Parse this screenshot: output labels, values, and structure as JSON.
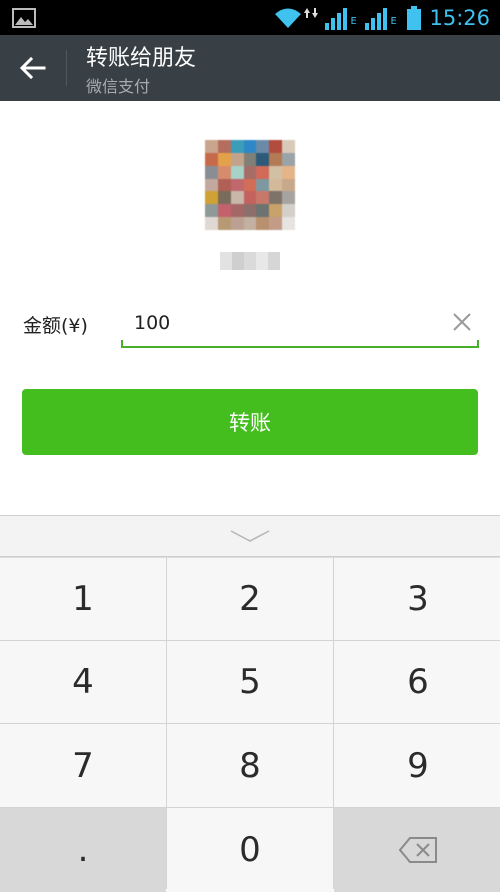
{
  "status_bar": {
    "time": "15:26",
    "network_badge_1": "E",
    "network_badge_2": "E",
    "icons": [
      "gallery-icon",
      "wifi-icon",
      "data-transfer-icon",
      "signal-icon",
      "signal-icon",
      "battery-icon"
    ],
    "time_color": "#3fc2ef"
  },
  "app_bar": {
    "title": "转账给朋友",
    "subtitle": "微信支付",
    "back_icon": "arrow-left-icon",
    "background": "#394045"
  },
  "amount": {
    "label": "金额(¥)",
    "value": "100",
    "clear_icon": "close-icon",
    "underline_color": "#46b02d"
  },
  "transfer_button": {
    "label": "转账",
    "color": "#44be1e"
  },
  "keyboard": {
    "collapse_icon": "chevron-down-icon",
    "keys": [
      "1",
      "2",
      "3",
      "4",
      "5",
      "6",
      "7",
      "8",
      "9",
      ".",
      "0"
    ],
    "delete_icon": "backspace-icon"
  }
}
